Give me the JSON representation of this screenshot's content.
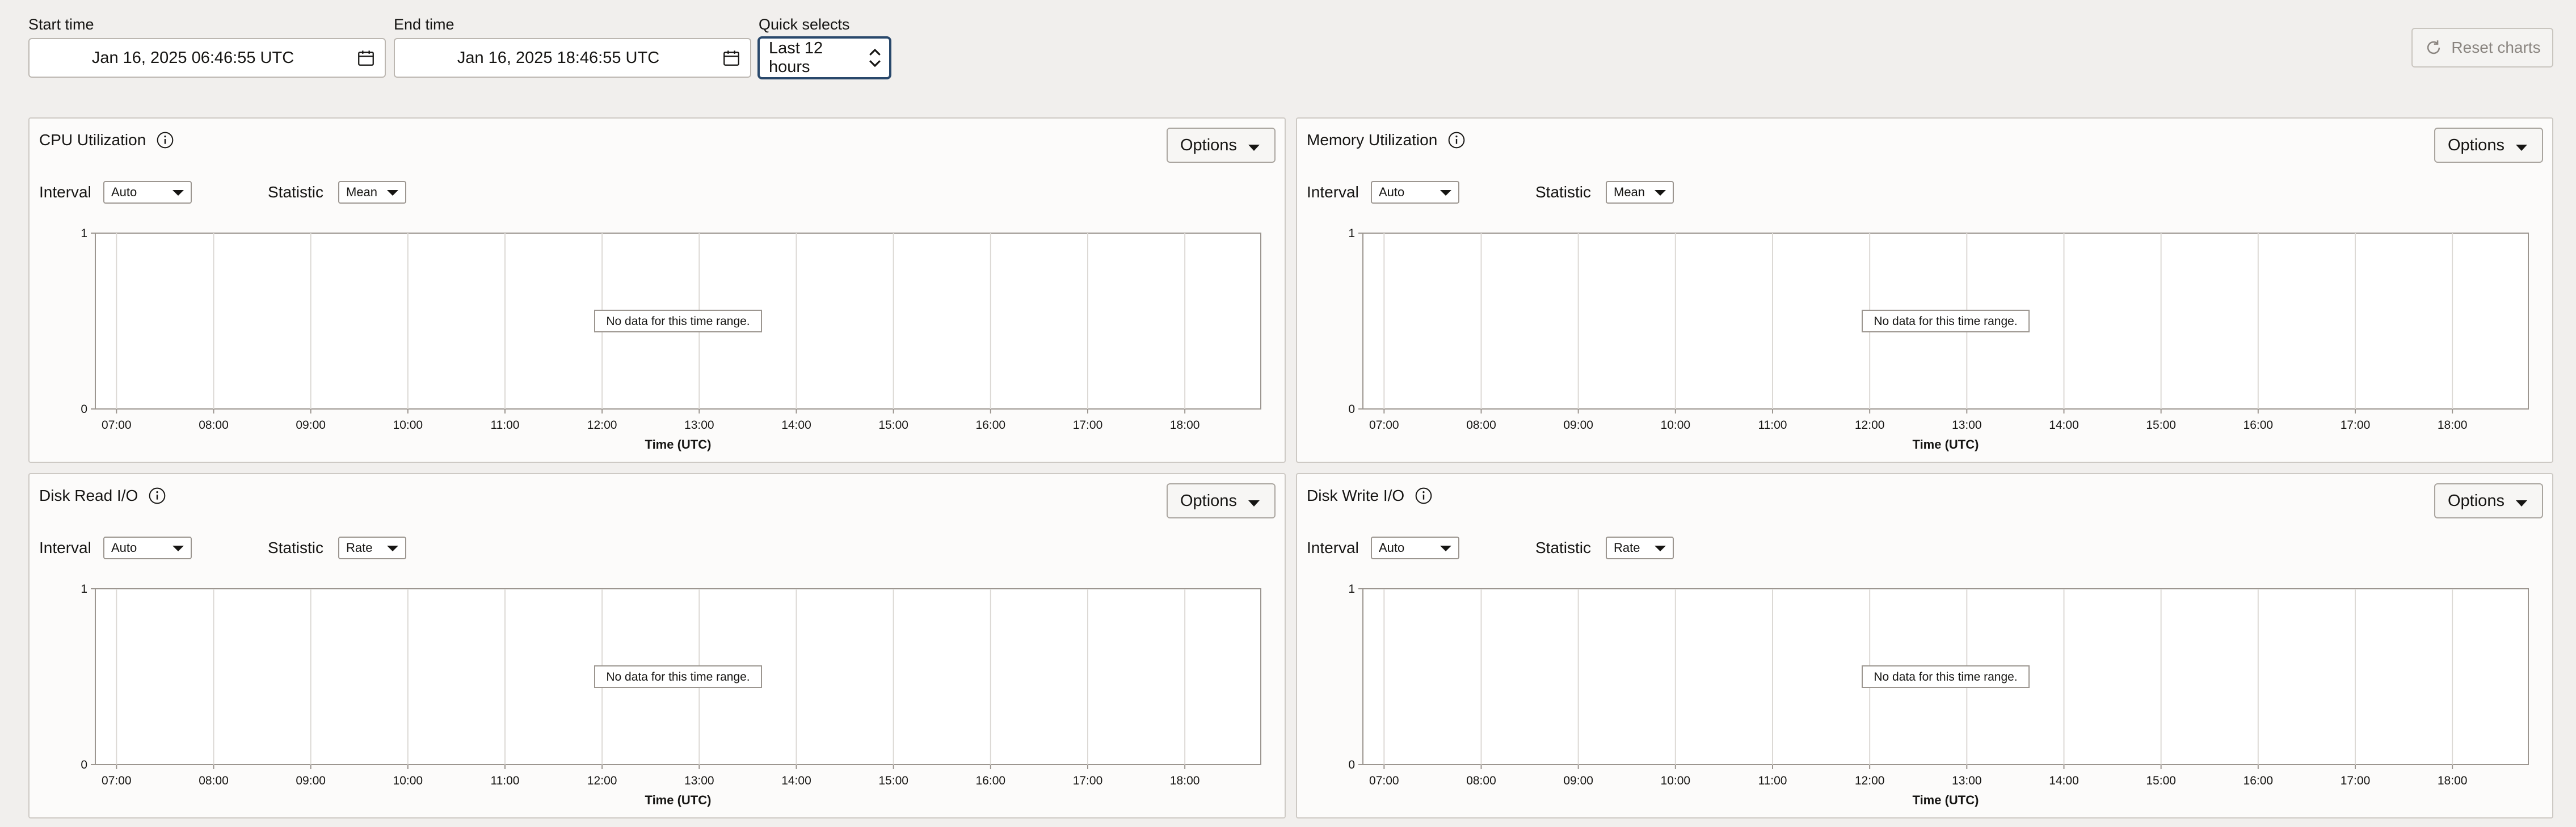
{
  "time_range": {
    "start_label": "Start time",
    "start_value": "Jan 16, 2025 06:46:55 UTC",
    "end_label": "End time",
    "end_value": "Jan 16, 2025 18:46:55 UTC",
    "quick_label": "Quick selects",
    "quick_value": "Last 12 hours"
  },
  "reset_label": "Reset charts",
  "common": {
    "options_label": "Options",
    "interval_label": "Interval",
    "statistic_label": "Statistic",
    "interval_value": "Auto",
    "no_data": "No data for this time range.",
    "x_title": "Time (UTC)",
    "y_ticks": [
      "1",
      "0"
    ],
    "x_ticks": [
      "07:00",
      "08:00",
      "09:00",
      "10:00",
      "11:00",
      "12:00",
      "13:00",
      "14:00",
      "15:00",
      "16:00",
      "17:00",
      "18:00"
    ]
  },
  "panels": [
    {
      "title": "CPU Utilization",
      "statistic": "Mean"
    },
    {
      "title": "Memory Utilization",
      "statistic": "Mean"
    },
    {
      "title": "Disk Read I/O",
      "statistic": "Rate"
    },
    {
      "title": "Disk Write I/O",
      "statistic": "Rate"
    }
  ],
  "chart_data": [
    {
      "type": "line",
      "title": "CPU Utilization",
      "xlabel": "Time (UTC)",
      "ylim": [
        0,
        1
      ],
      "x": [
        "07:00",
        "08:00",
        "09:00",
        "10:00",
        "11:00",
        "12:00",
        "13:00",
        "14:00",
        "15:00",
        "16:00",
        "17:00",
        "18:00"
      ],
      "series": [],
      "annotation": "No data for this time range.",
      "grid": "vertical"
    },
    {
      "type": "line",
      "title": "Memory Utilization",
      "xlabel": "Time (UTC)",
      "ylim": [
        0,
        1
      ],
      "x": [
        "07:00",
        "08:00",
        "09:00",
        "10:00",
        "11:00",
        "12:00",
        "13:00",
        "14:00",
        "15:00",
        "16:00",
        "17:00",
        "18:00"
      ],
      "series": [],
      "annotation": "No data for this time range.",
      "grid": "vertical"
    },
    {
      "type": "line",
      "title": "Disk Read I/O",
      "xlabel": "Time (UTC)",
      "ylim": [
        0,
        1
      ],
      "x": [
        "07:00",
        "08:00",
        "09:00",
        "10:00",
        "11:00",
        "12:00",
        "13:00",
        "14:00",
        "15:00",
        "16:00",
        "17:00",
        "18:00"
      ],
      "series": [],
      "annotation": "No data for this time range.",
      "grid": "vertical"
    },
    {
      "type": "line",
      "title": "Disk Write I/O",
      "xlabel": "Time (UTC)",
      "ylim": [
        0,
        1
      ],
      "x": [
        "07:00",
        "08:00",
        "09:00",
        "10:00",
        "11:00",
        "12:00",
        "13:00",
        "14:00",
        "15:00",
        "16:00",
        "17:00",
        "18:00"
      ],
      "series": [],
      "annotation": "No data for this time range.",
      "grid": "vertical"
    }
  ]
}
